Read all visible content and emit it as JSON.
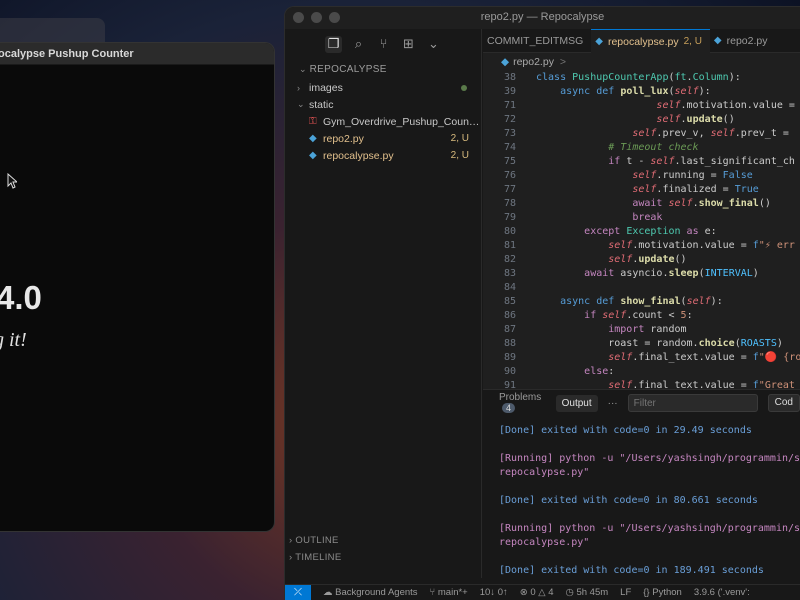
{
  "app": {
    "title": "ocalypse Pushup Counter",
    "count": "4.0",
    "motivation": "g it!"
  },
  "vscode": {
    "window_title": "repo2.py — Repocalypse",
    "explorer_title": "REPOCALYPSE",
    "tree": [
      {
        "name": "images",
        "type": "folder",
        "badge": "",
        "dot": true
      },
      {
        "name": "static",
        "type": "folder-open",
        "badge": "",
        "dot": false
      },
      {
        "name": "Gym_Overdrive_Pushup_Counter...",
        "type": "pdf",
        "badge": "",
        "dot": false
      },
      {
        "name": "repo2.py",
        "type": "py",
        "badge": "2, U",
        "dot": false
      },
      {
        "name": "repocalypse.py",
        "type": "py",
        "badge": "2, U",
        "dot": false
      }
    ],
    "sections": [
      "OUTLINE",
      "TIMELINE"
    ],
    "tabs": [
      {
        "label": "COMMIT_EDITMSG",
        "status": "",
        "icon": ""
      },
      {
        "label": "repocalypse.py",
        "status": "2, U",
        "icon": "python-icon"
      },
      {
        "label": "repo2.py",
        "status": "",
        "icon": "python-icon"
      }
    ],
    "breadcrumb": "repo2.py",
    "breadcrumb_sep": ">",
    "panel": {
      "problems_label": "Problems",
      "problems_count": "4",
      "output_label": "Output",
      "more_label": "···",
      "filter_placeholder": "Filter",
      "code_label": "Cod",
      "lines": [
        {
          "kind": "done",
          "text": "[Done] exited with code=0 in 29.49 seconds"
        },
        {
          "kind": "gap",
          "text": ""
        },
        {
          "kind": "run",
          "text": "[Running] python -u \"/Users/yashsingh/programmin/soyas"
        },
        {
          "kind": "run",
          "text": "repocalypse.py\""
        },
        {
          "kind": "gap",
          "text": ""
        },
        {
          "kind": "done",
          "text": "[Done] exited with code=0 in 80.661 seconds"
        },
        {
          "kind": "gap",
          "text": ""
        },
        {
          "kind": "run",
          "text": "[Running] python -u \"/Users/yashsingh/programmin/soyas"
        },
        {
          "kind": "run",
          "text": "repocalypse.py\""
        },
        {
          "kind": "gap",
          "text": ""
        },
        {
          "kind": "done",
          "text": "[Done] exited with code=0 in 189.491 seconds"
        }
      ]
    },
    "status": {
      "agents": "Background Agents",
      "branch": "main*+",
      "sync": "10↓ 0↑",
      "errors": "0",
      "warnings": "4",
      "time": "5h 45m",
      "eol": "LF",
      "lang": "Python",
      "version": "3.9.6 ('.venv':"
    }
  },
  "code": {
    "sticky": [
      {
        "n": "38",
        "html": "<span class='kb'>class</span> <span class='cls'>PushupCounterApp</span>(<span class='cls'>ft</span>.<span class='cls'>Column</span>):"
      },
      {
        "n": "39",
        "html": "    <span class='kb'>async</span> <span class='kb'>def</span> <span class='fn'>poll_lux</span>(<span class='sf'>self</span>):"
      }
    ],
    "lines": [
      {
        "n": "71",
        "html": "                    <span class='sf'>self</span>.motivation.value = "
      },
      {
        "n": "72",
        "html": "                    <span class='sf'>self</span>.<span class='fn'>update</span>()"
      },
      {
        "n": "73",
        "html": "                <span class='sf'>self</span>.prev_v, <span class='sf'>self</span>.prev_t = "
      },
      {
        "n": "74",
        "html": "            <span class='cm'># Timeout check</span>"
      },
      {
        "n": "75",
        "html": "            <span class='k'>if</span> t - <span class='sf'>self</span>.last_significant_ch"
      },
      {
        "n": "76",
        "html": "                <span class='sf'>self</span>.running = <span class='con'>False</span>"
      },
      {
        "n": "77",
        "html": "                <span class='sf'>self</span>.finalized = <span class='con'>True</span>"
      },
      {
        "n": "78",
        "html": "                <span class='k'>await</span> <span class='sf'>self</span>.<span class='fn'>show_final</span>()"
      },
      {
        "n": "79",
        "html": "                <span class='k'>break</span>"
      },
      {
        "n": "80",
        "html": "        <span class='k'>except</span> <span class='cls'>Exception</span> <span class='k'>as</span> e:"
      },
      {
        "n": "81",
        "html": "            <span class='sf'>self</span>.motivation.value = <span class='kb'>f</span><span class='str'>\"⚡ err</span>"
      },
      {
        "n": "82",
        "html": "            <span class='sf'>self</span>.<span class='fn'>update</span>()"
      },
      {
        "n": "83",
        "html": "        <span class='k'>await</span> asyncio.<span class='fn'>sleep</span>(<span class='nm'>INTERVAL</span>)"
      },
      {
        "n": "84",
        "html": ""
      },
      {
        "n": "85",
        "html": "    <span class='kb'>async</span> <span class='kb'>def</span> <span class='fn'>show_final</span>(<span class='sf'>self</span>):"
      },
      {
        "n": "86",
        "html": "        <span class='k'>if</span> <span class='sf'>self</span>.count &lt; <span class='str'>5</span>:"
      },
      {
        "n": "87",
        "html": "            <span class='k'>import</span> random"
      },
      {
        "n": "88",
        "html": "            roast = random.<span class='fn'>choice</span>(<span class='nm'>ROASTS</span>)"
      },
      {
        "n": "89",
        "html": "            <span class='sf'>self</span>.final_text.value = <span class='kb'>f</span><span class='str'>\"🔴 {roast}</span>"
      },
      {
        "n": "90",
        "html": "        <span class='k'>else</span>:"
      },
      {
        "n": "91",
        "html": "            <span class='sf'>self</span>.final_text.value = <span class='kb'>f</span><span class='str'>\"Great job</span>"
      }
    ]
  }
}
